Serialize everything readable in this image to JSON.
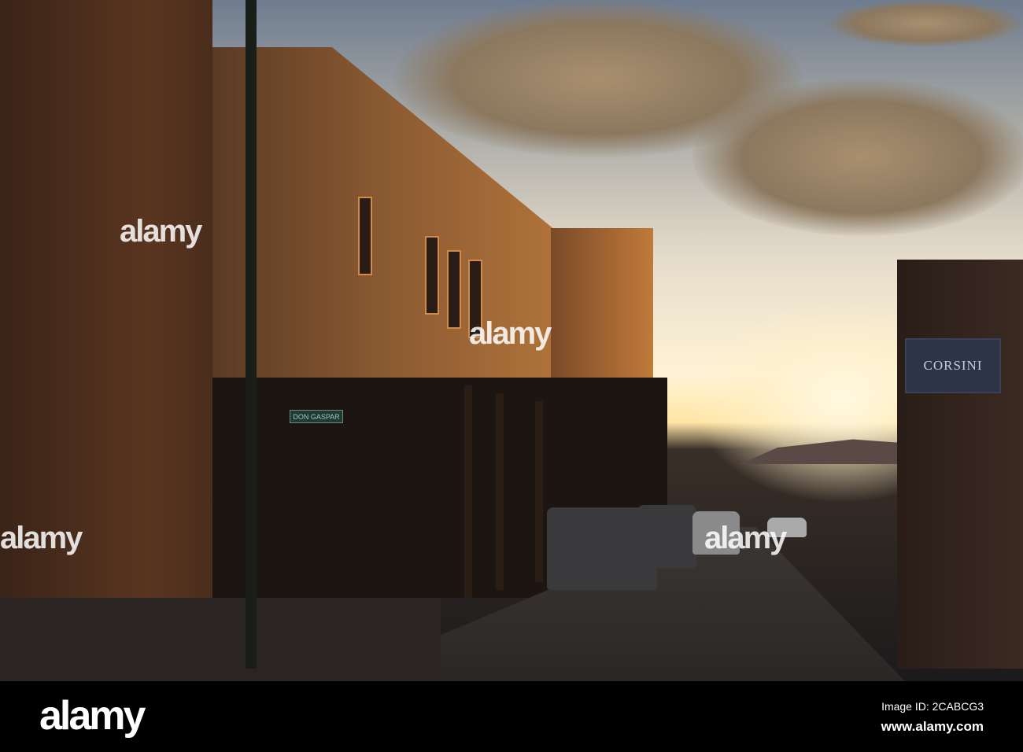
{
  "photo": {
    "description_alt": "Street at sunset",
    "watermark": "alamy",
    "signs": {
      "shop": "CORSINI",
      "street": "DON GASPAR"
    }
  },
  "footer": {
    "brand": "alamy",
    "image_id": "Image ID: 2CABCG3",
    "url": "www.alamy.com"
  }
}
